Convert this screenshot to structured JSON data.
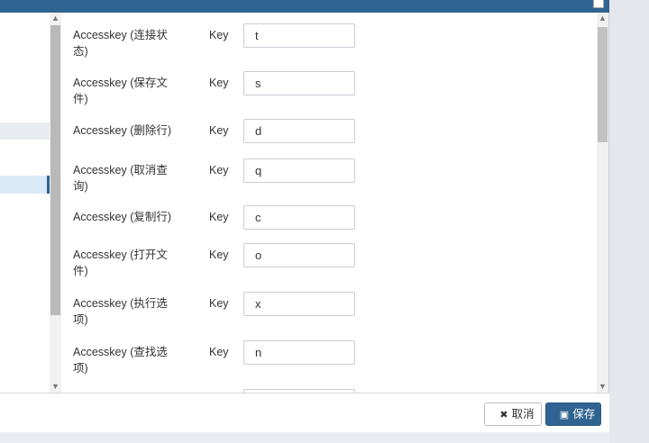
{
  "rows": [
    {
      "label": "Accesskey (连接状态)",
      "key_label": "Key",
      "value": "t"
    },
    {
      "label": "Accesskey (保存文件)",
      "key_label": "Key",
      "value": "s"
    },
    {
      "label": "Accesskey (删除行)",
      "key_label": "Key",
      "value": "d"
    },
    {
      "label": "Accesskey (取消查询)",
      "key_label": "Key",
      "value": "q"
    },
    {
      "label": "Accesskey (复制行)",
      "key_label": "Key",
      "value": "c"
    },
    {
      "label": "Accesskey (打开文件)",
      "key_label": "Key",
      "value": "o"
    },
    {
      "label": "Accesskey (执行选项)",
      "key_label": "Key",
      "value": "x"
    },
    {
      "label": "Accesskey (查找选项)",
      "key_label": "Key",
      "value": "n"
    },
    {
      "label": "",
      "key_label": "",
      "value": ""
    }
  ],
  "footer": {
    "cancel_label": "取消",
    "cancel_icon": "close-icon",
    "save_label": "保存",
    "save_icon": "save-icon"
  },
  "scroll_position": 0.0
}
